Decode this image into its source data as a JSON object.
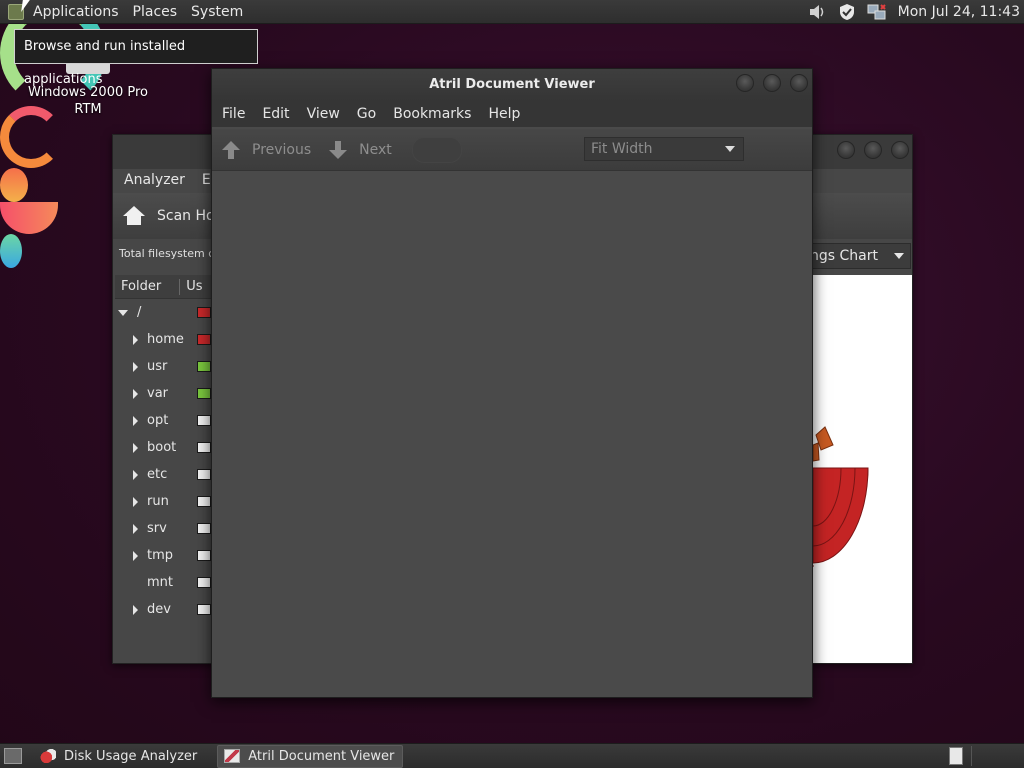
{
  "top_panel": {
    "menus": [
      "Applications",
      "Places",
      "System"
    ],
    "clock": "Mon Jul 24, 11:43"
  },
  "tooltip": "Browse and run installed applications",
  "desktop_icon": {
    "label": "Windows 2000 Pro RTM"
  },
  "disk_usage_analyzer": {
    "menus": [
      "Analyzer",
      "Ed"
    ],
    "toolbar_scan": "Scan Hon",
    "fs_capacity": "Total filesystem cap",
    "chart_select": "ngs Chart",
    "columns": [
      "Folder",
      "Us"
    ],
    "folders": [
      {
        "name": "/",
        "expanded": true,
        "usage_color": "#c8282a"
      },
      {
        "name": "home",
        "expanded": false,
        "usage_color": "#c8282a"
      },
      {
        "name": "usr",
        "expanded": false,
        "usage_color": "#7ac73e"
      },
      {
        "name": "var",
        "expanded": false,
        "usage_color": "#7ac73e"
      },
      {
        "name": "opt",
        "expanded": false,
        "usage_color": "#f2f2f2"
      },
      {
        "name": "boot",
        "expanded": false,
        "usage_color": "#f2f2f2"
      },
      {
        "name": "etc",
        "expanded": false,
        "usage_color": "#f2f2f2"
      },
      {
        "name": "run",
        "expanded": false,
        "usage_color": "#f2f2f2"
      },
      {
        "name": "srv",
        "expanded": false,
        "usage_color": "#f2f2f2"
      },
      {
        "name": "tmp",
        "expanded": false,
        "usage_color": "#f2f2f2"
      },
      {
        "name": "mnt",
        "expanded": null,
        "usage_color": "#f2f2f2"
      },
      {
        "name": "dev",
        "expanded": false,
        "usage_color": "#f2f2f2"
      }
    ]
  },
  "atril": {
    "title": "Atril Document Viewer",
    "menus": [
      "File",
      "Edit",
      "View",
      "Go",
      "Bookmarks",
      "Help"
    ],
    "previous_label": "Previous",
    "next_label": "Next",
    "zoom": "Fit Width"
  },
  "taskbar": {
    "tasks": [
      "Disk Usage Analyzer",
      "Atril Document Viewer"
    ],
    "active_task": "Atril Document Viewer"
  },
  "icons": {
    "tray": [
      "volume-icon",
      "shield-icon",
      "network-icon"
    ]
  }
}
